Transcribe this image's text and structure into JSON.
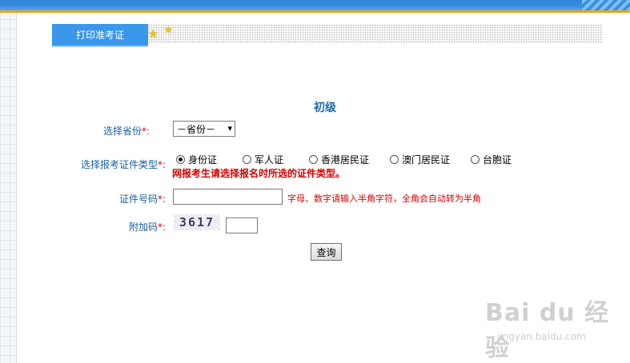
{
  "header": {
    "tab_label": "打印准考证"
  },
  "form": {
    "title": "初级",
    "province": {
      "label": "选择省份",
      "required_mark": "*",
      "colon": ":",
      "selected": "－省份－"
    },
    "id_type": {
      "label": "选择报考证件类型",
      "required_mark": "*",
      "colon": ":",
      "options": [
        {
          "label": "身份证",
          "checked": true
        },
        {
          "label": "军人证",
          "checked": false
        },
        {
          "label": "香港居民证",
          "checked": false
        },
        {
          "label": "澳门居民证",
          "checked": false
        },
        {
          "label": "台胞证",
          "checked": false
        }
      ],
      "warning": "网报考生请选择报名时所选的证件类型。"
    },
    "id_number": {
      "label": "证件号码",
      "required_mark": "*",
      "colon": ":",
      "value": "",
      "hint": "字母、数字请输入半角字符，全角会自动转为半角"
    },
    "captcha": {
      "label": "附加码",
      "required_mark": "*",
      "colon": ":",
      "code": "3617",
      "value": ""
    },
    "submit_label": "查询"
  },
  "watermark": {
    "text": "Bai du 经验",
    "sub": "jingyan.baidu.com"
  },
  "colors": {
    "top_bar": "#3a8fe0",
    "accent_stripe": "#f2a21a",
    "tab_bg": "#3a97ea",
    "label": "#1a5f9e",
    "required": "#e00000"
  }
}
